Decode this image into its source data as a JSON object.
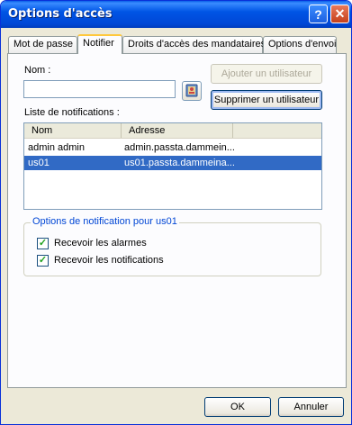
{
  "window": {
    "title": "Options d'accès",
    "help_glyph": "?",
    "close_glyph": "✕"
  },
  "tabs": [
    {
      "label": "Mot de passe"
    },
    {
      "label": "Notifier"
    },
    {
      "label": "Droits d'accès des mandataires"
    },
    {
      "label": "Options d'envoi"
    }
  ],
  "notifier": {
    "name_label": "Nom :",
    "name_value": "",
    "add_user_label": "Ajouter un utilisateur",
    "remove_user_label": "Supprimer un utilisateur",
    "list_label": "Liste de notifications :",
    "columns": [
      "Nom",
      "Adresse"
    ],
    "rows": [
      {
        "name": "admin admin",
        "address": "admin.passta.dammein..."
      },
      {
        "name": "us01",
        "address": "us01.passta.dammeina..."
      }
    ],
    "group_title": "Options de notification pour us01",
    "receive_alarms_label": "Recevoir les alarmes",
    "receive_alarms_checked": true,
    "receive_notifications_label": "Recevoir les notifications",
    "receive_notifications_checked": true
  },
  "footer": {
    "ok_label": "OK",
    "cancel_label": "Annuler"
  },
  "colors": {
    "titlebar": "#0055e5",
    "selection": "#316ac5",
    "group_title": "#0046d5"
  }
}
